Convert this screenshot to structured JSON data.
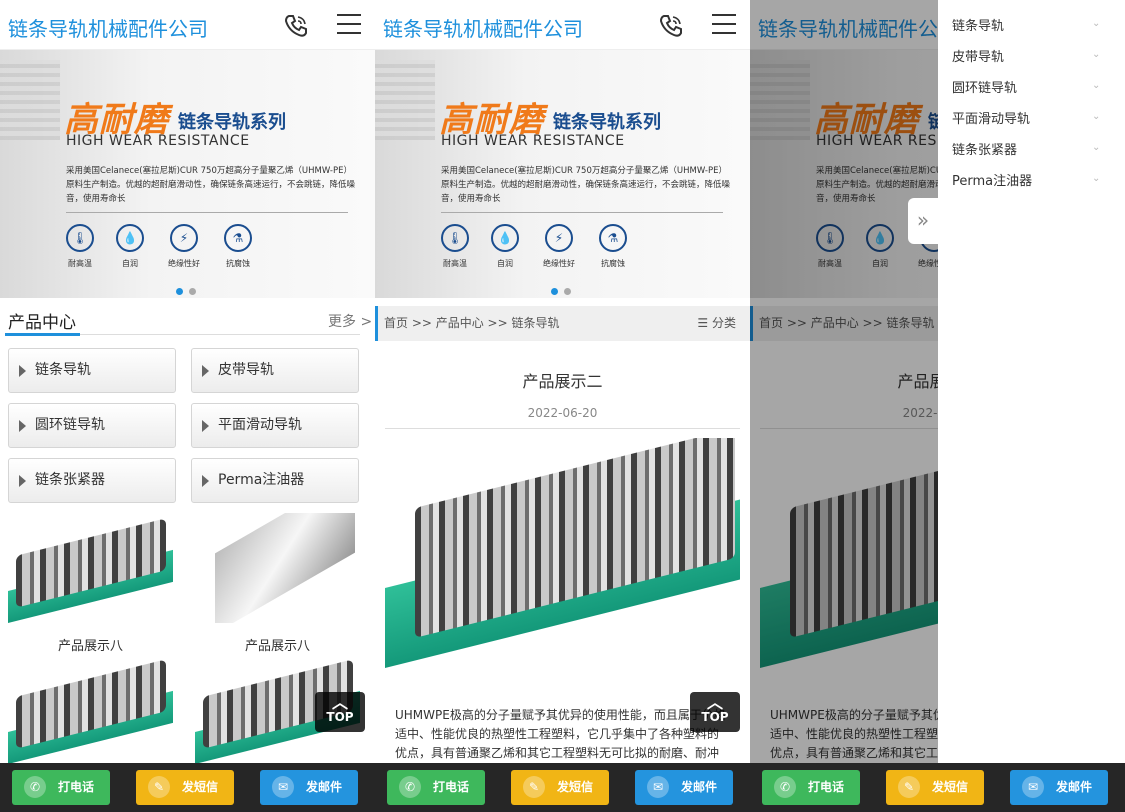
{
  "header": {
    "logo": "链条导轨机械配件公司"
  },
  "banner": {
    "title_big": "高耐磨",
    "title_sub": "链条导轨系列",
    "title_en": "HIGH WEAR RESISTANCE",
    "desc": "采用美国Celanece(塞拉尼斯)CUR 750万超高分子量聚乙烯（UHMW-PE）原料生产制造。优越的超耐磨滑动性，确保链条高速运行，不会跳链，降低噪音，使用寿命长",
    "features": [
      "耐高温",
      "自润",
      "绝缘性好",
      "抗腐蚀"
    ]
  },
  "products": {
    "heading": "产品中心",
    "more": "更多 >",
    "categories": [
      "链条导轨",
      "皮带导轨",
      "圆环链导轨",
      "平面滑动导轨",
      "链条张紧器",
      "Perma注油器"
    ],
    "items": [
      "产品展示八",
      "产品展示八"
    ]
  },
  "top_label": "TOP",
  "detail": {
    "breadcrumb": "首页 >> 产品中心 >> 链条导轨",
    "categories_label": "分类",
    "title": "产品展示二",
    "date": "2022-06-20",
    "body": "UHMWPE极高的分子量赋予其优异的使用性能，而且属于价格适中、性能优良的热塑性工程塑料，它几乎集中了各种塑料的优点，具有普通聚乙烯和其它工程塑料无可比拟的耐磨、耐冲"
  },
  "footer": {
    "call": "打电话",
    "sms": "发短信",
    "email": "发邮件"
  },
  "drawer": {
    "items": [
      "链条导轨",
      "皮带导轨",
      "圆环链导轨",
      "平面滑动导轨",
      "链条张紧器",
      "Perma注油器"
    ]
  }
}
